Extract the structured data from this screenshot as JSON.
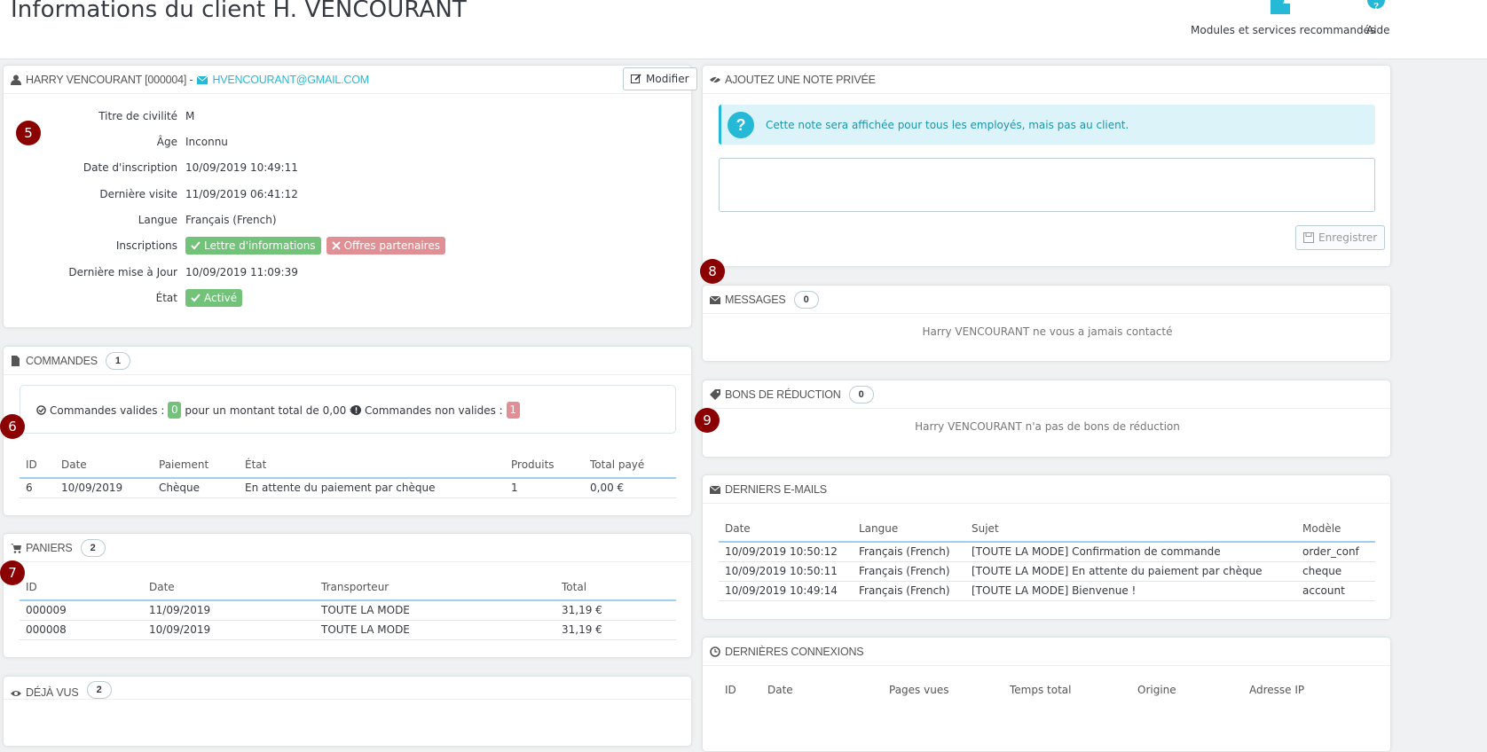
{
  "header": {
    "title": "Informations du client H. VENCOURANT",
    "actions": [
      {
        "label": "Modules et services recommandés",
        "icon": "puzzle-icon"
      },
      {
        "label": "Aide",
        "icon": "help-icon"
      }
    ]
  },
  "customer": {
    "name": "HARRY VENCOURANT [000004] -",
    "email": "HVENCOURANT@GMAIL.COM",
    "edit_label": "Modifier",
    "fields": [
      {
        "label": "Titre de civilité",
        "value": "M"
      },
      {
        "label": "Âge",
        "value": "Inconnu"
      },
      {
        "label": "Date d'inscription",
        "value": "10/09/2019 10:49:11"
      },
      {
        "label": "Dernière visite",
        "value": "11/09/2019 06:41:12"
      },
      {
        "label": "Langue",
        "value": "Français (French)"
      },
      {
        "label": "Inscriptions",
        "value": ""
      },
      {
        "label": "Dernière mise à Jour",
        "value": "10/09/2019 11:09:39"
      },
      {
        "label": "État",
        "value": ""
      }
    ],
    "subscriptions": {
      "newsletter": "Lettre d'informations",
      "partners": "Offres partenaires"
    },
    "state": "Activé"
  },
  "orders": {
    "title": "COMMANDES",
    "count": "1",
    "valid_label": "Commandes valides :",
    "valid_count": "0",
    "valid_total": "pour un montant total de 0,00 €",
    "invalid_label": "Commandes non valides :",
    "invalid_count": "1",
    "columns": [
      "ID",
      "Date",
      "Paiement",
      "État",
      "Produits",
      "Total payé"
    ],
    "rows": [
      {
        "id": "6",
        "date": "10/09/2019",
        "payment": "Chèque",
        "state": "En attente du paiement par chèque",
        "products": "1",
        "total": "0,00 €"
      }
    ]
  },
  "carts": {
    "title": "PANIERS",
    "count": "2",
    "columns": [
      "ID",
      "Date",
      "Transporteur",
      "Total"
    ],
    "rows": [
      {
        "id": "000009",
        "date": "11/09/2019",
        "carrier": "TOUTE LA MODE",
        "total": "31,19 €"
      },
      {
        "id": "000008",
        "date": "10/09/2019",
        "carrier": "TOUTE LA MODE",
        "total": "31,19 €"
      }
    ]
  },
  "viewed": {
    "title": "DÉJÀ VUS",
    "count": "2"
  },
  "note": {
    "title": "AJOUTEZ UNE NOTE PRIVÉE",
    "info": "Cette note sera affichée pour tous les employés, mais pas au client.",
    "save_label": "Enregistrer"
  },
  "messages": {
    "title": "MESSAGES",
    "count": "0",
    "empty": "Harry VENCOURANT ne vous a jamais contacté"
  },
  "vouchers": {
    "title": "BONS DE RÉDUCTION",
    "count": "0",
    "empty": "Harry VENCOURANT n'a pas de bons de réduction"
  },
  "emails": {
    "title": "DERNIERS E-MAILS",
    "columns": [
      "Date",
      "Langue",
      "Sujet",
      "Modèle"
    ],
    "rows": [
      {
        "date": "10/09/2019 10:50:12",
        "lang": "Français (French)",
        "subject": "[TOUTE LA MODE] Confirmation de commande",
        "template": "order_conf"
      },
      {
        "date": "10/09/2019 10:50:11",
        "lang": "Français (French)",
        "subject": "[TOUTE LA MODE] En attente du paiement par chèque",
        "template": "cheque"
      },
      {
        "date": "10/09/2019 10:49:14",
        "lang": "Français (French)",
        "subject": "[TOUTE LA MODE] Bienvenue !",
        "template": "account"
      }
    ]
  },
  "connections": {
    "title": "DERNIÈRES CONNEXIONS",
    "columns": [
      "ID",
      "Date",
      "Pages vues",
      "Temps total",
      "Origine",
      "Adresse IP"
    ]
  },
  "steps": [
    "5",
    "6",
    "7",
    "8",
    "9"
  ],
  "colors": {
    "accent": "#25b9d7",
    "success": "#72c279",
    "danger": "#e08f95",
    "step": "#8b0000"
  }
}
